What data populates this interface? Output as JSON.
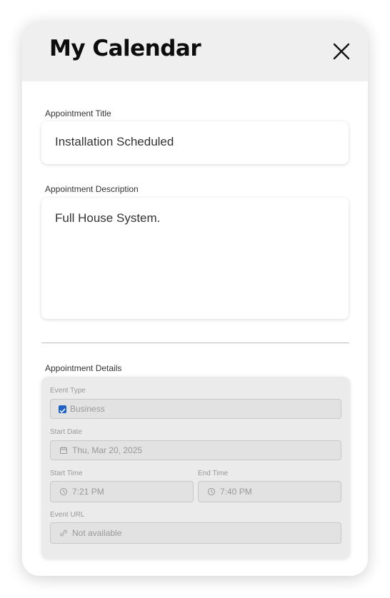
{
  "header": {
    "title": "My Calendar",
    "close_icon": "close-icon"
  },
  "form": {
    "title_label": "Appointment Title",
    "title_value": "Installation Scheduled",
    "description_label": "Appointment Description",
    "description_value": "Full House System.",
    "details_label": "Appointment Details"
  },
  "details": {
    "event_type_label": "Event Type",
    "event_type_value": "Business",
    "event_type_checked": true,
    "start_date_label": "Start Date",
    "start_date_value": "Thu, Mar 20, 2025",
    "start_time_label": "Start Time",
    "start_time_value": "7:21 PM",
    "end_time_label": "End Time",
    "end_time_value": "7:40 PM",
    "event_url_label": "Event URL",
    "event_url_value": "Not available"
  },
  "colors": {
    "header_bg": "#efefef",
    "checkbox": "#1f62c4",
    "details_bg": "#ebebeb",
    "disabled_text": "#999999"
  }
}
